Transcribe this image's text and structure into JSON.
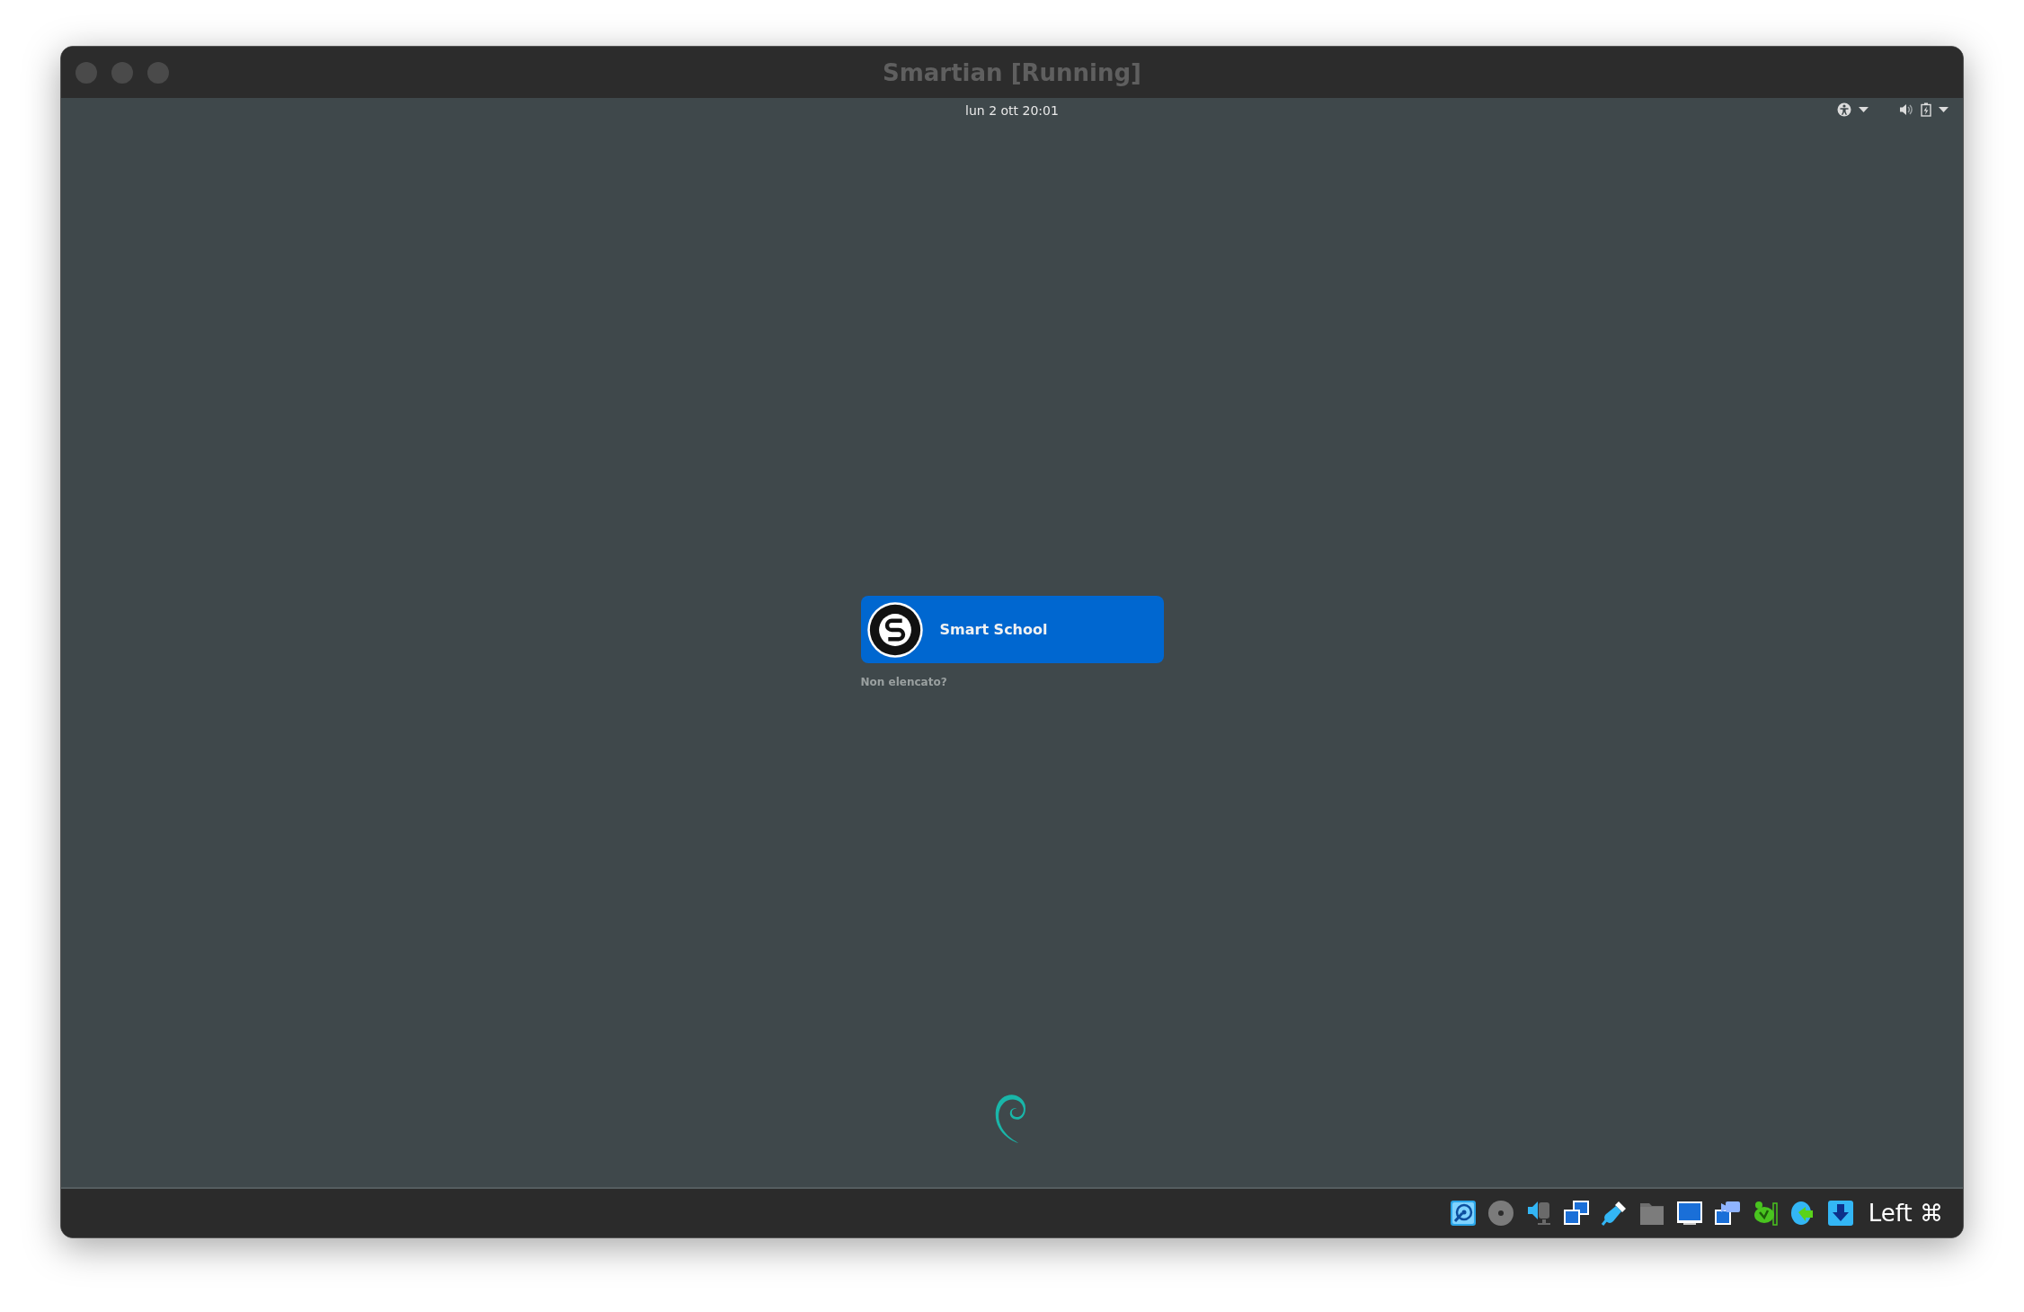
{
  "window": {
    "title": "Smartian [Running]"
  },
  "top_bar": {
    "clock": "lun 2 ott  20:01"
  },
  "login": {
    "users": [
      {
        "name": "Smart School"
      }
    ],
    "not_listed": "Non elencato?"
  },
  "status_bar": {
    "host_key": "Left ⌘"
  }
}
